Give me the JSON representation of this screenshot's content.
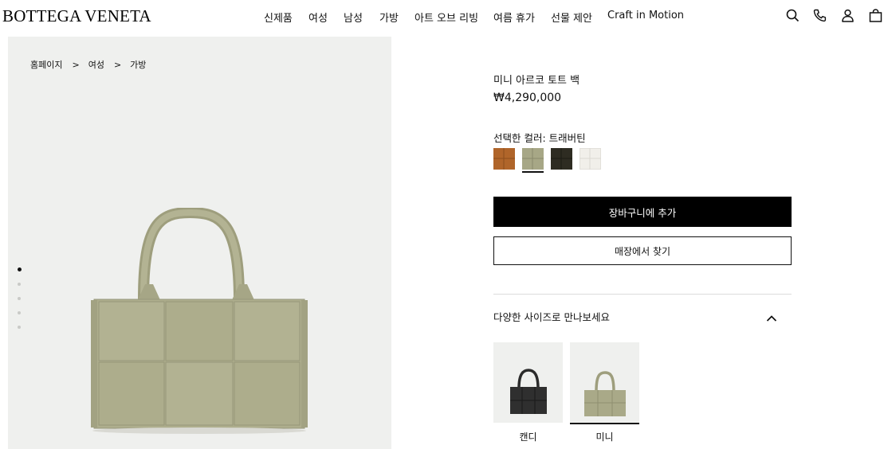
{
  "brand": {
    "logo_text": "BOTTEGA VENETA"
  },
  "nav": {
    "items": [
      "신제품",
      "여성",
      "남성",
      "가방",
      "아트 오브 리빙",
      "여름 휴가",
      "선물 제안",
      "Craft in Motion"
    ]
  },
  "utility_icons": [
    "search-icon",
    "phone-icon",
    "account-icon",
    "bag-icon"
  ],
  "breadcrumb": [
    "홈페이지",
    "여성",
    "가방"
  ],
  "gallery": {
    "image_count": 5,
    "active_index": 1
  },
  "product": {
    "title": "미니 아르코 토트 백",
    "price": "₩4,290,000",
    "color_label": "선택한 컬러: 트래버틴",
    "swatches": [
      {
        "name": "caramel",
        "color": "#b0652a"
      },
      {
        "name": "travertine",
        "color": "#a7a786",
        "selected": true
      },
      {
        "name": "dark-moss",
        "color": "#2e2c22"
      },
      {
        "name": "chalk",
        "color": "#f1efea"
      }
    ]
  },
  "actions": {
    "add_to_cart": "장바구니에 추가",
    "find_in_store": "매장에서 찾기"
  },
  "sizes": {
    "heading": "다양한 사이즈로 만나보세요",
    "options": [
      {
        "label": "캔디",
        "color": "#2b2b2b",
        "active": false
      },
      {
        "label": "미니",
        "color": "#a7a786",
        "active": true
      }
    ]
  },
  "colors": {
    "accent": "#000000",
    "panel_bg": "#eff0ee"
  }
}
